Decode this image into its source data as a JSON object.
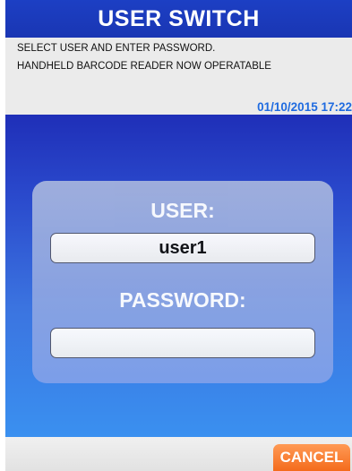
{
  "header": {
    "title": "USER SWITCH",
    "background_color": "#1c3fc4"
  },
  "info": {
    "line1": "SELECT USER AND ENTER PASSWORD.",
    "line2": "HANDHELD BARCODE READER NOW OPERATABLE",
    "datetime": "01/10/2015 17:22",
    "datetime_color": "#1f6be0"
  },
  "login": {
    "user_label": "USER:",
    "user_value": "user1",
    "password_label": "PASSWORD:",
    "password_value": ""
  },
  "footer": {
    "cancel_label": "CANCEL",
    "cancel_color": "#f46b1c"
  }
}
